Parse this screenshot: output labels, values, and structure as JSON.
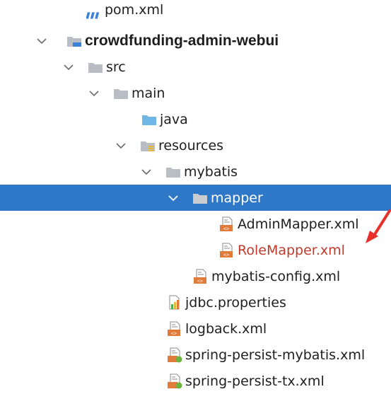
{
  "tree": {
    "rows": [
      {
        "label": "pom.xml",
        "icon": "maven-icon"
      },
      {
        "label": "crowdfunding-admin-webui",
        "icon": "module-folder-icon",
        "expanded": true
      },
      {
        "label": "src",
        "icon": "folder-icon",
        "expanded": true
      },
      {
        "label": "main",
        "icon": "folder-icon",
        "expanded": true
      },
      {
        "label": "java",
        "icon": "source-folder-icon"
      },
      {
        "label": "resources",
        "icon": "resources-folder-icon",
        "expanded": true
      },
      {
        "label": "mybatis",
        "icon": "folder-icon",
        "expanded": true
      },
      {
        "label": "mapper",
        "icon": "folder-icon",
        "expanded": true,
        "selected": true
      },
      {
        "label": "AdminMapper.xml",
        "icon": "xml-file-icon"
      },
      {
        "label": "RoleMapper.xml",
        "icon": "xml-file-icon",
        "highlight": "red"
      },
      {
        "label": "mybatis-config.xml",
        "icon": "xml-file-icon"
      },
      {
        "label": "jdbc.properties",
        "icon": "properties-file-icon"
      },
      {
        "label": "logback.xml",
        "icon": "xml-file-icon"
      },
      {
        "label": "spring-persist-mybatis.xml",
        "icon": "spring-xml-file-icon"
      },
      {
        "label": "spring-persist-tx.xml",
        "icon": "spring-xml-file-icon"
      }
    ]
  },
  "colors": {
    "selection": "#2f78c8",
    "folder": "#b9bec4",
    "source_folder": "#6fb7e6",
    "xml_icon": "#e07b39",
    "red_label": "#c0392b",
    "annotation_arrow": "#e8302a"
  }
}
